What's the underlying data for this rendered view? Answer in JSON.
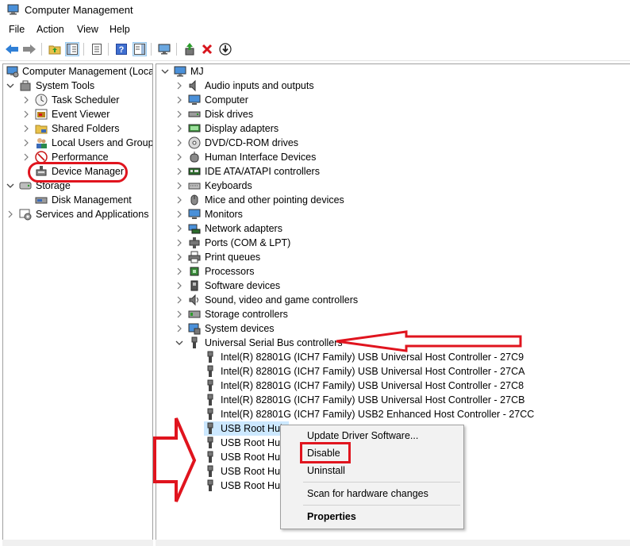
{
  "window": {
    "title": "Computer Management",
    "icon": "computer-management-icon"
  },
  "menu": [
    "File",
    "Action",
    "View",
    "Help"
  ],
  "toolbar": {
    "buttons": [
      "back-arrow-icon",
      "forward-arrow-icon",
      "folder-up-icon",
      "show-hide-tree-icon",
      "properties-icon",
      "help-icon",
      "show-hide-action-pane-icon",
      "monitor-icon",
      "update-driver-icon",
      "uninstall-x-icon",
      "scan-download-icon"
    ]
  },
  "left_tree": {
    "root": "Computer Management (Local",
    "system_tools": "System Tools",
    "task_scheduler": "Task Scheduler",
    "event_viewer": "Event Viewer",
    "shared_folders": "Shared Folders",
    "local_users": "Local Users and Groups",
    "performance": "Performance",
    "device_manager": "Device Manager",
    "storage": "Storage",
    "disk_management": "Disk Management",
    "services_apps": "Services and Applications"
  },
  "device_tree": {
    "computer_name": "MJ",
    "categories": [
      "Audio inputs and outputs",
      "Computer",
      "Disk drives",
      "Display adapters",
      "DVD/CD-ROM drives",
      "Human Interface Devices",
      "IDE ATA/ATAPI controllers",
      "Keyboards",
      "Mice and other pointing devices",
      "Monitors",
      "Network adapters",
      "Ports (COM & LPT)",
      "Print queues",
      "Processors",
      "Software devices",
      "Sound, video and game controllers",
      "Storage controllers",
      "System devices",
      "Universal Serial Bus controllers"
    ],
    "usb_children": [
      "Intel(R) 82801G (ICH7 Family) USB Universal Host Controller - 27C9",
      "Intel(R) 82801G (ICH7 Family) USB Universal Host Controller - 27CA",
      "Intel(R) 82801G (ICH7 Family) USB Universal Host Controller - 27C8",
      "Intel(R) 82801G (ICH7 Family) USB Universal Host Controller - 27CB",
      "Intel(R) 82801G (ICH7 Family) USB2 Enhanced Host Controller - 27CC",
      "USB Root Hub",
      "USB Root Hub",
      "USB Root Hub",
      "USB Root Hub",
      "USB Root Hub"
    ]
  },
  "context_menu": {
    "update": "Update Driver Software...",
    "disable": "Disable",
    "uninstall": "Uninstall",
    "scan": "Scan for hardware changes",
    "properties": "Properties"
  },
  "colors": {
    "annotation_red": "#e0141e",
    "selection": "#cce8ff"
  }
}
